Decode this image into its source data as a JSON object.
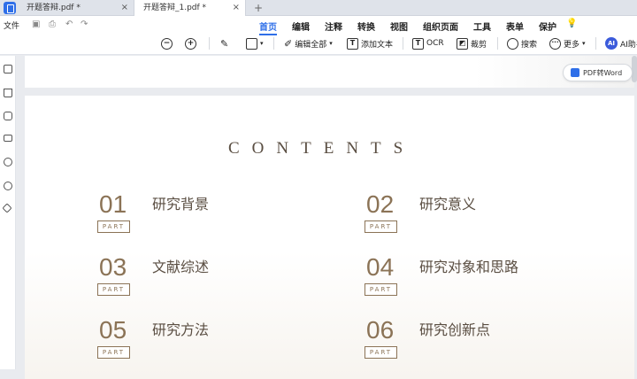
{
  "tabs": [
    {
      "label": "开题答辩.pdf *"
    },
    {
      "label": "开题答辩_1.pdf *"
    }
  ],
  "tab_add": "+",
  "tab_close": "×",
  "file_menu": "文件",
  "menus": [
    "首页",
    "编辑",
    "注释",
    "转换",
    "视图",
    "组织页面",
    "工具",
    "表单",
    "保护"
  ],
  "tools": {
    "edit_all": "编辑全部",
    "add_text": "添加文本",
    "ocr": "OCR",
    "crop": "裁剪",
    "search": "搜索",
    "more": "更多",
    "ai": "AI助手"
  },
  "pdf_to_word": "PDF转Word",
  "document": {
    "heading": "CONTENTS",
    "part_label": "PART",
    "items": [
      {
        "num": "01",
        "label": "研究背景"
      },
      {
        "num": "02",
        "label": "研究意义"
      },
      {
        "num": "03",
        "label": "文献综述"
      },
      {
        "num": "04",
        "label": "研究对象和思路"
      },
      {
        "num": "05",
        "label": "研究方法"
      },
      {
        "num": "06",
        "label": "研究创新点"
      }
    ]
  },
  "colors": {
    "accent": "#2f6fe8",
    "brown": "#8b7356",
    "text_dark": "#5a4e42"
  }
}
